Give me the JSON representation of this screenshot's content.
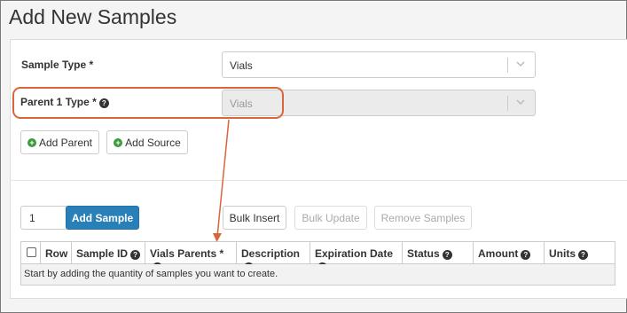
{
  "page": {
    "title": "Add New Samples"
  },
  "form": {
    "sample_type": {
      "label": "Sample Type *",
      "value": "Vials"
    },
    "parent_type": {
      "label": "Parent 1 Type  *",
      "value": "Vials"
    },
    "add_parent_label": "Add Parent",
    "add_source_label": "Add Source"
  },
  "toolbar": {
    "quantity": "1",
    "add_sample_label": "Add Sample",
    "bulk_insert_label": "Bulk Insert",
    "bulk_update_label": "Bulk Update",
    "remove_samples_label": "Remove Samples"
  },
  "grid": {
    "columns": [
      "Row",
      "Sample ID",
      "Vials Parents  *",
      "Description",
      "Expiration Date",
      "Status",
      "Amount",
      "Units"
    ],
    "empty_message": "Start by adding the quantity of samples you want to create."
  },
  "colors": {
    "accent": "#2980b9",
    "callout": "#d9663a",
    "add_icon": "#3c9a3c"
  },
  "icons": {
    "help": "question-circle-icon",
    "add": "plus-circle-icon",
    "dropdown": "chevron-down-icon"
  }
}
